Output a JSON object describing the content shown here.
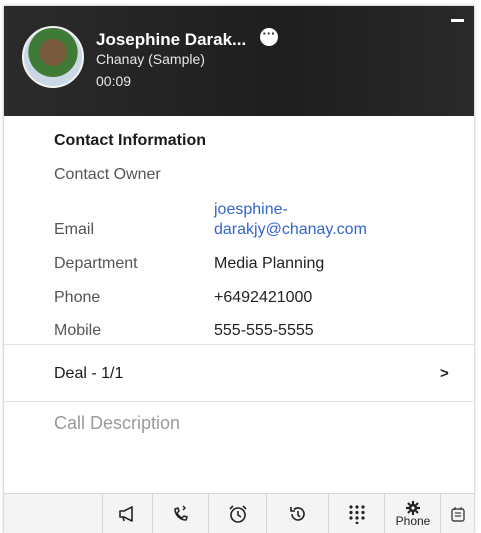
{
  "header": {
    "contact_name": "Josephine Darak...",
    "company": "Chanay (Sample)",
    "timer": "00:09",
    "more_icon": "more-horizontal-icon",
    "minimize_icon": "minimize-icon"
  },
  "contact_info": {
    "title": "Contact Information",
    "fields": [
      {
        "label": "Contact Owner",
        "value": ""
      },
      {
        "label": "Email",
        "value_line1": "joesphine-",
        "value_line2": "darakjy@chanay.com"
      },
      {
        "label": "Department",
        "value": "Media Planning"
      },
      {
        "label": "Phone",
        "value": "+6492421000"
      },
      {
        "label": "Mobile",
        "value": "555-555-5555"
      }
    ]
  },
  "deal": {
    "label": "Deal - 1/1",
    "chevron": ">"
  },
  "call_description": {
    "placeholder": "Call Description"
  },
  "toolbar": {
    "items": [
      {
        "icon": "megaphone-icon"
      },
      {
        "icon": "callback-icon"
      },
      {
        "icon": "alarm-clock-icon"
      },
      {
        "icon": "history-icon"
      },
      {
        "icon": "dialpad-icon"
      },
      {
        "icon": "gear-icon",
        "label": "Phone"
      },
      {
        "icon": "notes-icon"
      }
    ]
  },
  "colors": {
    "header_bg": "#1e1e1e",
    "link": "#3366cc",
    "placeholder": "#9a9a9a",
    "toolbar_bg": "#f4f4f4"
  }
}
